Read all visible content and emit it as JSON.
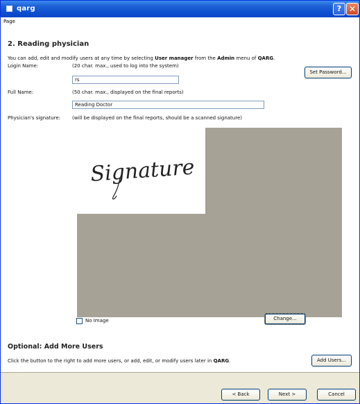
{
  "window": {
    "title": "qarg"
  },
  "titlebar": {
    "help_label": "?",
    "close_label": "✕"
  },
  "menubar": {
    "page_label": "Page"
  },
  "section": {
    "title": "2. Reading physician",
    "info_pre": "You can add, edit and modify users at any time by selecting ",
    "info_bold1": "User manager",
    "info_mid": " from the ",
    "info_bold2": "Admin",
    "info_post": " menu of ",
    "info_bold3": "QARG",
    "info_end": "."
  },
  "login": {
    "label": "Login Name:",
    "hint": "(20 char. max., used to log into the system)",
    "value": "rs"
  },
  "set_password_button": "Set Password...",
  "full_name": {
    "label": "Full Name:",
    "hint": "(50 char. max., displayed on the final reports)",
    "value": "Reading Doctor"
  },
  "signature": {
    "label": "Physician's signature:",
    "hint": "(will be displayed on the final reports, should be a scanned signature)",
    "image_text": "Signature"
  },
  "no_image": {
    "label": "No Image",
    "checked": false
  },
  "change_button": "Change...",
  "optional": {
    "title": "Optional: Add More Users",
    "text_pre": "Click the button to the right to add more users, or add, edit, or modify users later in ",
    "text_bold": "QARG",
    "text_end": "."
  },
  "add_users_button": "Add Users...",
  "footer": {
    "back_button": "< Back",
    "next_button": "Next >",
    "cancel_button": "Cancel"
  }
}
